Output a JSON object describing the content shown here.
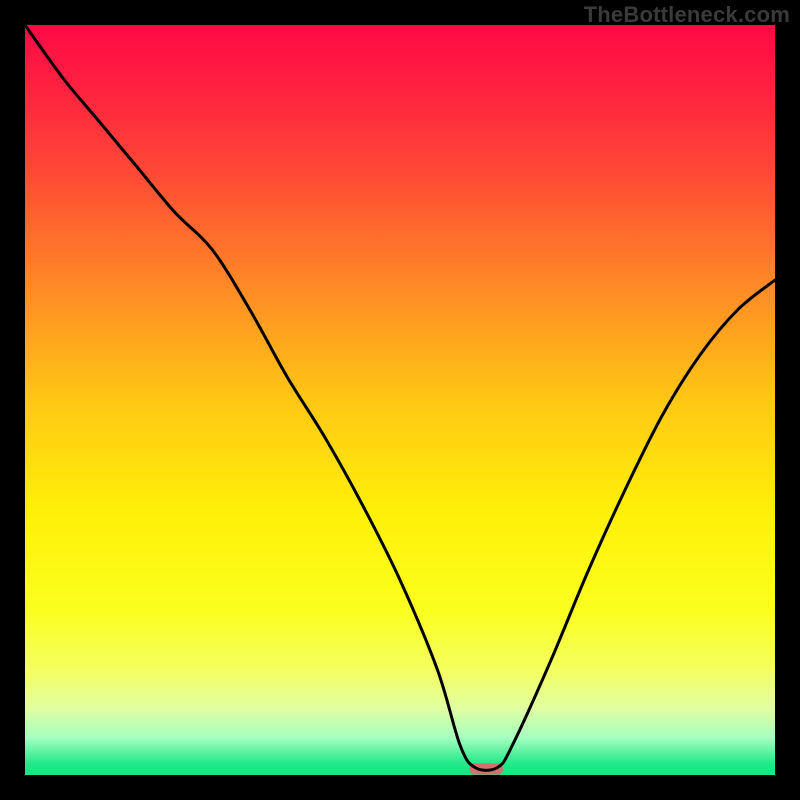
{
  "watermark": "TheBottleneck.com",
  "chart_data": {
    "type": "line",
    "title": "",
    "xlabel": "",
    "ylabel": "",
    "xlim": [
      0,
      100
    ],
    "ylim": [
      0,
      100
    ],
    "grid": false,
    "legend": false,
    "plot_background": "vertical-rainbow-gradient",
    "gradient_stops": [
      {
        "offset": 0.0,
        "color": "#ff0a45"
      },
      {
        "offset": 0.08,
        "color": "#ff2040"
      },
      {
        "offset": 0.2,
        "color": "#ff4a35"
      },
      {
        "offset": 0.35,
        "color": "#ff8a25"
      },
      {
        "offset": 0.5,
        "color": "#ffc714"
      },
      {
        "offset": 0.65,
        "color": "#fff008"
      },
      {
        "offset": 0.78,
        "color": "#fbff1e"
      },
      {
        "offset": 0.86,
        "color": "#f4ff60"
      },
      {
        "offset": 0.91,
        "color": "#e2ffa0"
      },
      {
        "offset": 0.95,
        "color": "#a6ffc0"
      },
      {
        "offset": 0.985,
        "color": "#20e988"
      },
      {
        "offset": 1.0,
        "color": "#18e586"
      }
    ],
    "series": [
      {
        "name": "bottleneck-curve",
        "color": "#000000",
        "x": [
          0,
          5,
          10,
          15,
          20,
          25,
          30,
          35,
          40,
          45,
          50,
          55,
          58,
          60,
          63,
          65,
          70,
          75,
          80,
          85,
          90,
          95,
          100
        ],
        "y": [
          100,
          93,
          87,
          81,
          75,
          70,
          62,
          53,
          45,
          36,
          26,
          14,
          4,
          1,
          1,
          4,
          15,
          27,
          38,
          48,
          56,
          62,
          66
        ]
      }
    ],
    "optimum_marker": {
      "x": 61.5,
      "y": 0.8,
      "width": 4.5,
      "height": 1.5,
      "color": "#d36f6c",
      "shape": "rounded-rect"
    }
  }
}
